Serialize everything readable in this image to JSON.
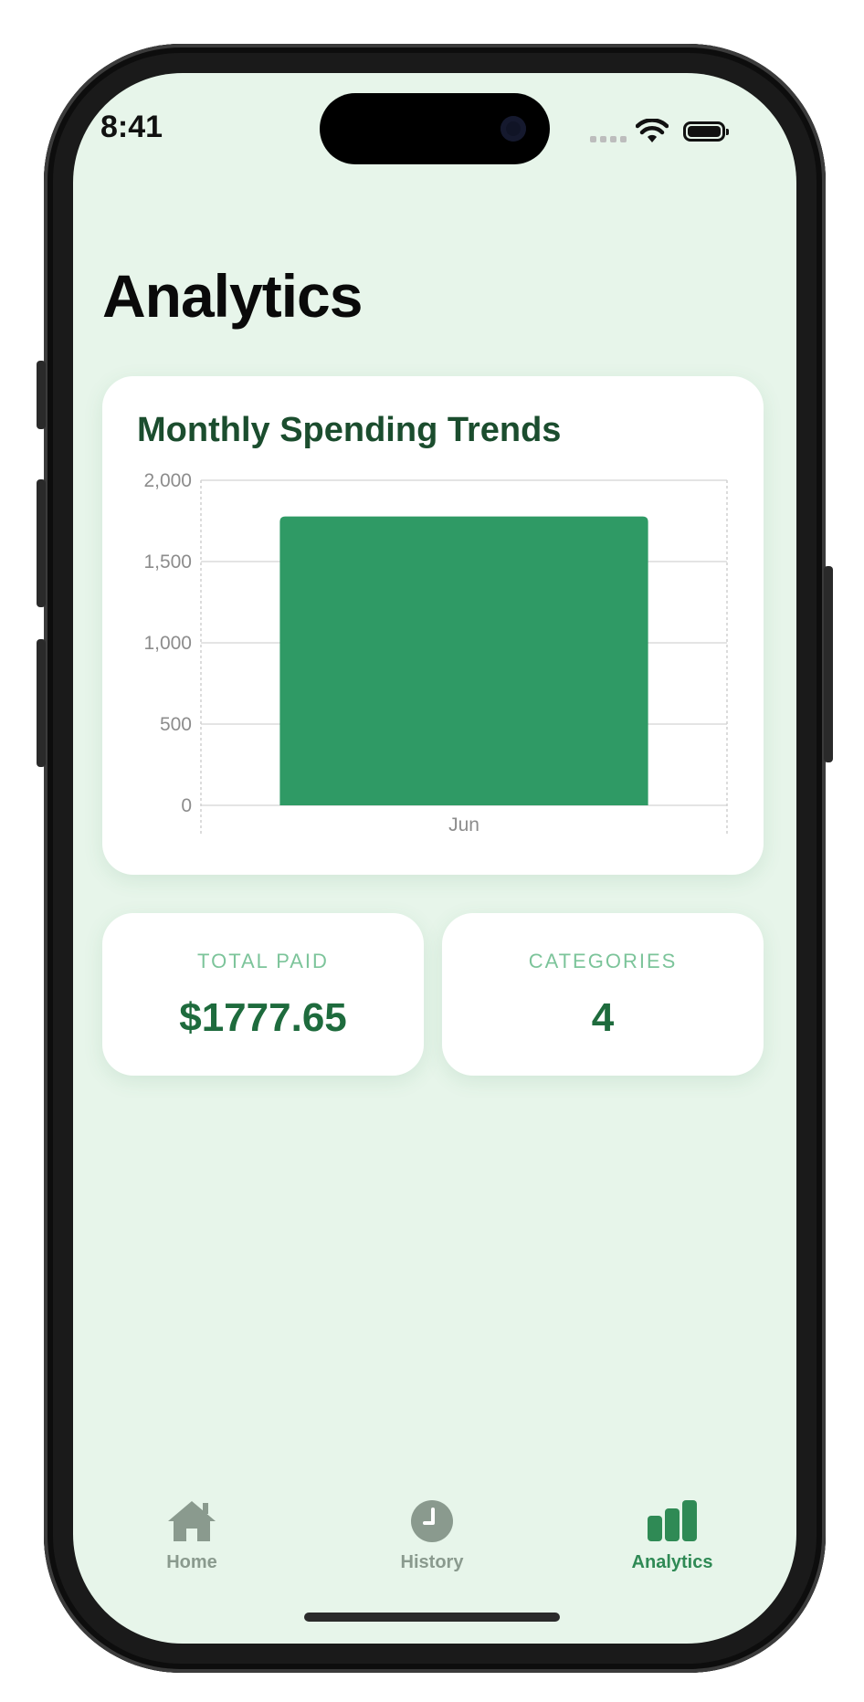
{
  "status_bar": {
    "time": "8:41"
  },
  "page": {
    "title": "Analytics"
  },
  "chart_card": {
    "title": "Monthly Spending Trends"
  },
  "chart_data": {
    "type": "bar",
    "categories": [
      "Jun"
    ],
    "values": [
      1777.65
    ],
    "ylim": [
      0,
      2000
    ],
    "yticks": [
      "2,000",
      "1,500",
      "1,000",
      "500",
      "0"
    ],
    "xlabel": "",
    "ylabel": "",
    "grid": true,
    "bar_color": "#2f9a65"
  },
  "stats": {
    "total_paid": {
      "label": "TOTAL PAID",
      "value": "$1777.65"
    },
    "categories": {
      "label": "CATEGORIES",
      "value": "4"
    }
  },
  "tab_bar": {
    "items": [
      {
        "label": "Home",
        "icon": "home-icon",
        "active": false
      },
      {
        "label": "History",
        "icon": "clock-icon",
        "active": false
      },
      {
        "label": "Analytics",
        "icon": "bar-chart-icon",
        "active": true
      }
    ],
    "active_color": "#2f8a55",
    "inactive_color": "#8a9a8e"
  }
}
